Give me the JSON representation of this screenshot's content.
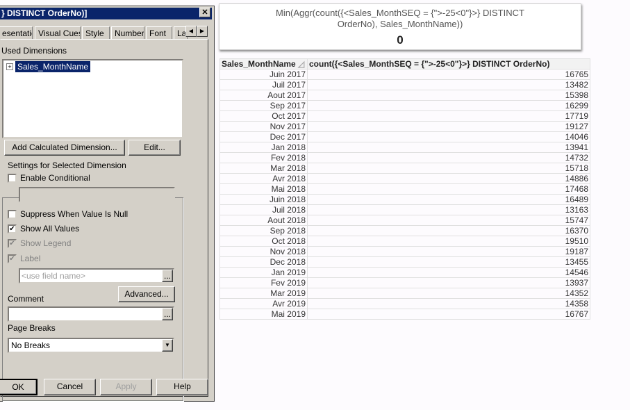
{
  "dialog": {
    "title": "} DISTINCT OrderNo)]",
    "tabs": [
      "esentation",
      "Visual Cues",
      "Style",
      "Number",
      "Font",
      "La"
    ],
    "used_dimensions_label": "Used Dimensions",
    "dimensions": [
      "Sales_MonthName"
    ],
    "add_calc_label": "Add Calculated Dimension...",
    "edit_label": "Edit...",
    "settings_label": "Settings for Selected Dimension",
    "enable_conditional": "Enable Conditional",
    "suppress_null": "Suppress When Value Is Null",
    "show_all_values": "Show All Values",
    "show_legend": "Show Legend",
    "label": "Label",
    "label_placeholder": "<use field name>",
    "ellipsis": "...",
    "advanced_label": "Advanced...",
    "comment_label": "Comment",
    "page_breaks_label": "Page Breaks",
    "page_breaks_value": "No Breaks",
    "ok": "OK",
    "cancel": "Cancel",
    "apply": "Apply",
    "help": "Help",
    "close": "✕"
  },
  "textbox": {
    "expression": "Min(Aggr(count({<Sales_MonthSEQ = {\">-25<0\"}>} DISTINCT OrderNo), Sales_MonthName))",
    "value": "0"
  },
  "table": {
    "headers": [
      "Sales_MonthName",
      "count({<Sales_MonthSEQ = {\">-25<0\"}>} DISTINCT OrderNo)"
    ],
    "rows": [
      [
        "Juin 2017",
        "16765"
      ],
      [
        "Juil 2017",
        "13482"
      ],
      [
        "Aout 2017",
        "15398"
      ],
      [
        "Sep 2017",
        "16299"
      ],
      [
        "Oct 2017",
        "17719"
      ],
      [
        "Nov 2017",
        "19127"
      ],
      [
        "Dec 2017",
        "14046"
      ],
      [
        "Jan 2018",
        "13941"
      ],
      [
        "Fev 2018",
        "14732"
      ],
      [
        "Mar 2018",
        "15718"
      ],
      [
        "Avr 2018",
        "14886"
      ],
      [
        "Mai 2018",
        "17468"
      ],
      [
        "Juin 2018",
        "16489"
      ],
      [
        "Juil 2018",
        "13163"
      ],
      [
        "Aout 2018",
        "15747"
      ],
      [
        "Sep 2018",
        "16370"
      ],
      [
        "Oct 2018",
        "19510"
      ],
      [
        "Nov 2018",
        "19187"
      ],
      [
        "Dec 2018",
        "13455"
      ],
      [
        "Jan 2019",
        "14546"
      ],
      [
        "Fev 2019",
        "13937"
      ],
      [
        "Mar 2019",
        "14352"
      ],
      [
        "Avr 2019",
        "14358"
      ],
      [
        "Mai 2019",
        "16767"
      ]
    ]
  }
}
